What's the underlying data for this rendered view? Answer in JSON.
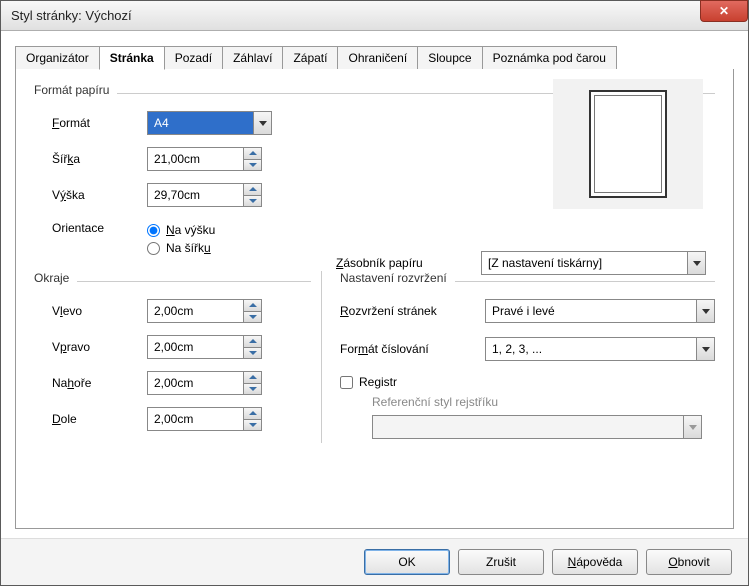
{
  "window": {
    "title": "Styl stránky: Výchozí"
  },
  "tabs": [
    "Organizátor",
    "Stránka",
    "Pozadí",
    "Záhlaví",
    "Zápatí",
    "Ohraničení",
    "Sloupce",
    "Poznámka pod čarou"
  ],
  "active_tab": 1,
  "paper": {
    "group": "Formát papíru",
    "format_label": "Formát",
    "format_value": "A4",
    "width_label": "Šířka",
    "width_value": "21,00cm",
    "height_label": "Výška",
    "height_value": "29,70cm",
    "orient_label": "Orientace",
    "orient_portrait": "Na výšku",
    "orient_landscape": "Na šířku",
    "tray_label": "Zásobník papíru",
    "tray_value": "[Z nastavení tiskárny]"
  },
  "margins": {
    "group": "Okraje",
    "left_label": "Vlevo",
    "left_value": "2,00cm",
    "right_label": "Vpravo",
    "right_value": "2,00cm",
    "top_label": "Nahoře",
    "top_value": "2,00cm",
    "bottom_label": "Dole",
    "bottom_value": "2,00cm"
  },
  "layout": {
    "group": "Nastavení rozvržení",
    "pagelayout_label": "Rozvržení stránek",
    "pagelayout_value": "Pravé i levé",
    "numbering_label": "Formát číslování",
    "numbering_value": "1, 2, 3, ...",
    "register_label": "Registr",
    "refstyle_label": "Referenční styl rejstříku",
    "refstyle_value": ""
  },
  "buttons": {
    "ok": "OK",
    "cancel": "Zrušit",
    "help": "Nápověda",
    "reset": "Obnovit"
  }
}
